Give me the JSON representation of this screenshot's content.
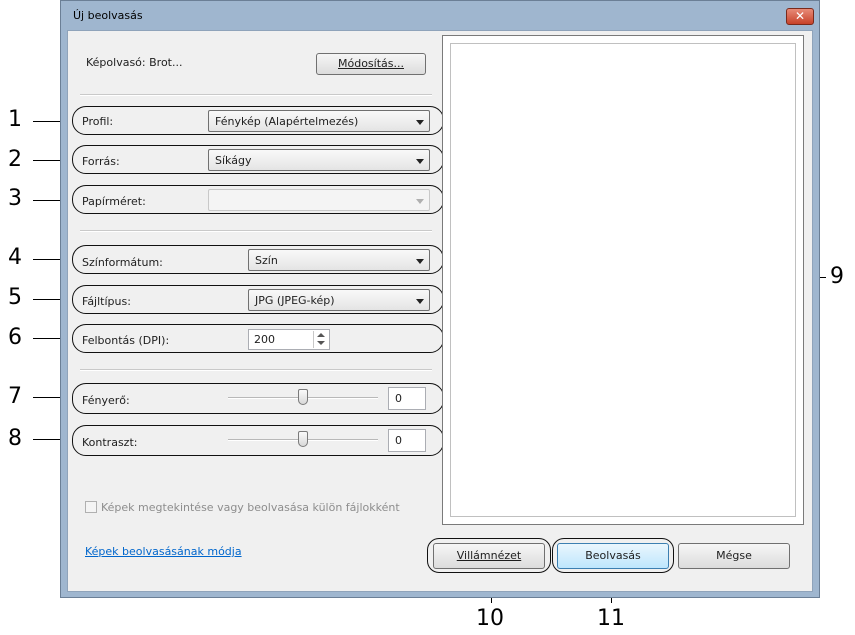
{
  "dialog": {
    "title": "Új beolvasás",
    "close_label": "✕"
  },
  "scanner": {
    "label": "Képolvasó: Brot...",
    "change_button": "Módosítás..."
  },
  "fields": {
    "profile": {
      "label": "Profil:",
      "value": "Fénykép (Alapértelmezés)"
    },
    "source": {
      "label": "Forrás:",
      "value": "Síkágy"
    },
    "paper_size": {
      "label": "Papírméret:",
      "value": ""
    },
    "color_format": {
      "label": "Színformátum:",
      "value": "Szín"
    },
    "file_type": {
      "label": "Fájltípus:",
      "value": "JPG (JPEG-kép)"
    },
    "resolution": {
      "label": "Felbontás (DPI):",
      "value": "200"
    },
    "brightness": {
      "label": "Fényerő:",
      "value": "0",
      "level": 0.5
    },
    "contrast": {
      "label": "Kontraszt:",
      "value": "0",
      "level": 0.5
    }
  },
  "separate_files_checkbox": {
    "label": "Képek megtekintése vagy beolvasása külön fájlokként",
    "checked": false
  },
  "help_link": "Képek beolvasásának módja",
  "buttons": {
    "preview": "Villámnézet",
    "scan": "Beolvasás",
    "cancel": "Mégse"
  },
  "callouts": [
    "1",
    "2",
    "3",
    "4",
    "5",
    "6",
    "7",
    "8",
    "9",
    "10",
    "11"
  ]
}
